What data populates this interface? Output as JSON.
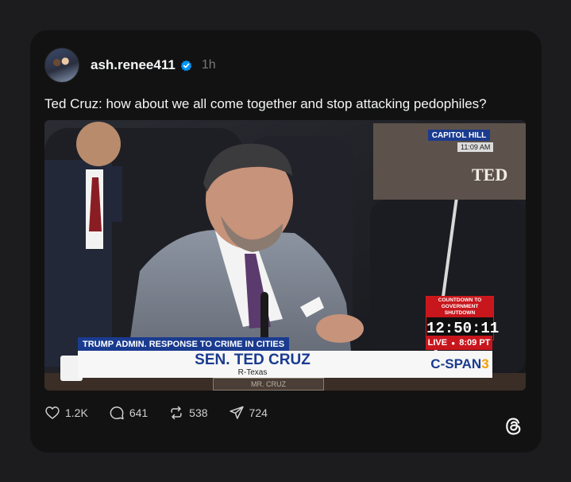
{
  "post": {
    "username": "ash.renee411",
    "time": "1h",
    "text": "Ted Cruz: how about we all come together and stop attacking pedophiles?"
  },
  "video": {
    "capitol_bug": "CAPITOL HILL",
    "capitol_time": "11:09 AM",
    "nameplate": "TED",
    "countdown_title": "COUNTDOWN TO GOVERNMENT SHUTDOWN",
    "countdown_clock": "12:50:11",
    "live_label": "LIVE",
    "live_time": "8:09 PT",
    "topic": "TRUMP ADMIN. RESPONSE TO CRIME IN CITIES",
    "speaker_name": "SEN. TED CRUZ",
    "speaker_party": "R-Texas",
    "desk_plate": "MR. CRUZ",
    "network": "C-SPAN",
    "network_num": "3"
  },
  "actions": {
    "likes": "1.2K",
    "replies": "641",
    "reposts": "538",
    "shares": "724"
  },
  "icons": {
    "verified": "verified-badge-icon",
    "like": "heart-icon",
    "reply": "comment-bubble-icon",
    "repost": "repost-icon",
    "share": "send-icon",
    "brand": "threads-logo-icon"
  },
  "colors": {
    "background": "#1c1c1e",
    "card": "#121212",
    "verified_blue": "#0095f6",
    "cspan_blue": "#1a3b8f",
    "live_red": "#c8161d"
  }
}
